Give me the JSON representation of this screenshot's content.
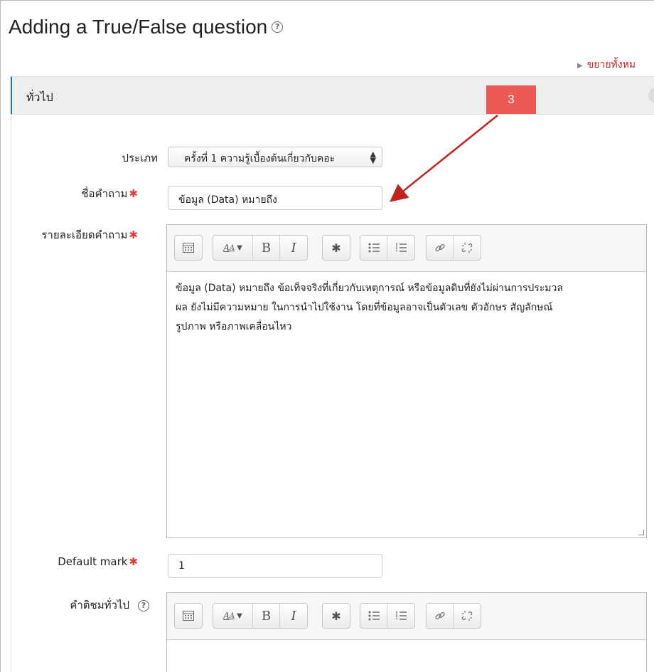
{
  "page": {
    "title": "Adding a True/False question",
    "expand_all": "ขยายทั้งหม"
  },
  "section": {
    "title": "ทั่วไป",
    "collapse": "-"
  },
  "callout": {
    "number": "3"
  },
  "fields": {
    "category": {
      "label": "ประเภท",
      "value": "ครั้งที่ 1 ความรู้เบื้องต้นเกี่ยวกับคอะ"
    },
    "question_name": {
      "label": "ชื่อคำถาม",
      "value": "ข้อมูล (Data) หมายถึง"
    },
    "question_text": {
      "label": "รายละเอียดคำถาม",
      "lines": [
        "ข้อมูล (Data) หมายถึง ข้อเท็จจริงที่เกี่ยวกับเหตุการณ์ หรือข้อมูลดิบที่ยังไม่ผ่านการประมวล",
        "ผล ยังไม่มีความหมาย ในการนำไปใช้งาน โดยที่ข้อมูลอาจเป็นตัวเลข ตัวอักษร สัญลักษณ์",
        "รูปภาพ หรือภาพเคลื่อนไหว"
      ]
    },
    "default_mark": {
      "label": "Default mark",
      "value": "1"
    },
    "general_feedback": {
      "label": "คำติชมทั่วไป"
    }
  },
  "required_marker": "✱",
  "help_glyph": "?",
  "toolbar": {
    "b": "B",
    "i": "I",
    "icons": [
      "toolbar-toggle-icon",
      "font-style-icon",
      "bold-icon",
      "italic-icon",
      "gear-icon",
      "bullet-list-icon",
      "numbered-list-icon",
      "link-icon",
      "unlink-icon"
    ]
  },
  "colors": {
    "accent": "#1177d1",
    "required": "#e53935",
    "callout": "#ed5a56",
    "arrow": "#c0241c"
  }
}
